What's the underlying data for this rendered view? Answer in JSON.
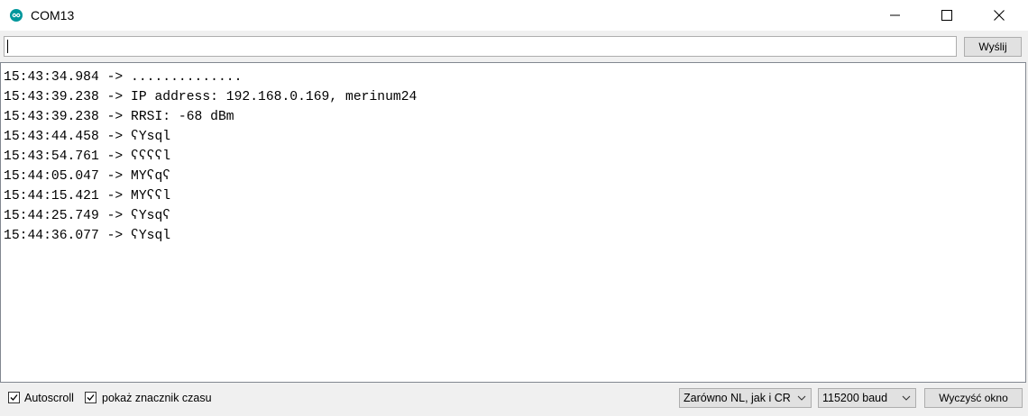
{
  "window": {
    "title": "COM13",
    "controls": [
      "minimize-icon",
      "maximize-icon",
      "close-icon"
    ]
  },
  "send": {
    "input_value": "",
    "button_label": "Wyślij"
  },
  "console": {
    "lines": [
      "15:43:34.984 -> ..............",
      "15:43:39.238 -> IP address: 192.168.0.169, merinum24",
      "15:43:39.238 -> RRSI: -68 dBm",
      "15:43:44.458 -> ʕYsql",
      "15:43:54.761 -> ʕʕʕʕl",
      "15:44:05.047 -> MYʕqʕ",
      "15:44:15.421 -> MYʕʕl",
      "15:44:25.749 -> ʕYsqʕ",
      "15:44:36.077 -> ʕYsql"
    ]
  },
  "status": {
    "autoscroll_label": "Autoscroll",
    "autoscroll_checked": true,
    "timestamp_label": "pokaż znacznik czasu",
    "timestamp_checked": true,
    "line_ending": "Zarówno NL, jak i CR",
    "baud": "115200 baud",
    "clear_label": "Wyczyść okno"
  },
  "colors": {
    "app_icon": "#00979c",
    "titlebar": "#ffffff",
    "chrome": "#f0f0f0"
  }
}
